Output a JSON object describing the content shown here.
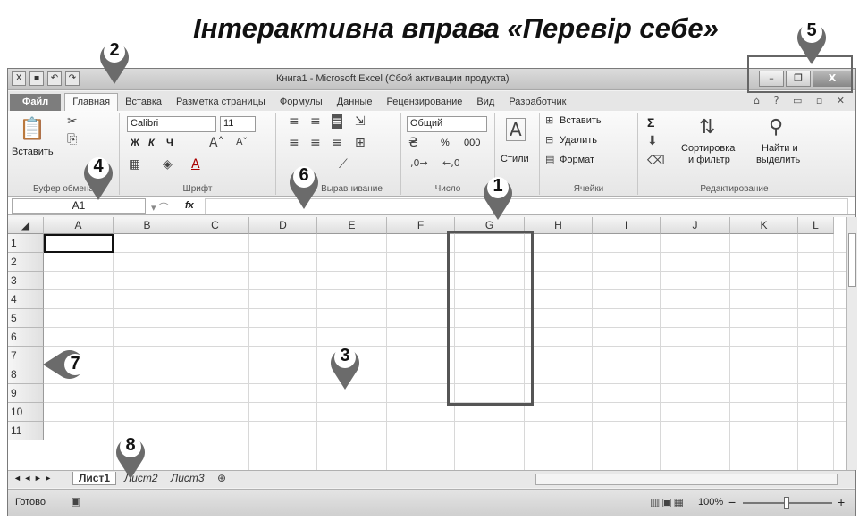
{
  "heading": "Інтерактивна вправа «Перевір себе»",
  "window": {
    "title": "Книга1 - Microsoft Excel (Сбой активации продукта)",
    "qat_icons": [
      "excel-icon",
      "save-icon",
      "undo-icon",
      "redo-icon"
    ],
    "controls": [
      "minimize",
      "restore",
      "close"
    ]
  },
  "tabs": [
    "Файл",
    "Главная",
    "Вставка",
    "Разметка страницы",
    "Формулы",
    "Данные",
    "Рецензирование",
    "Вид",
    "Разработчик"
  ],
  "ribbon": {
    "clipboard": {
      "paste": "Вставить",
      "label": "Буфер обмена"
    },
    "font": {
      "name": "Calibri",
      "size": "11",
      "bold": "Ж",
      "italic": "К",
      "underline": "Ч",
      "label": "Шрифт"
    },
    "alignment": {
      "label": "Выравнивание"
    },
    "number": {
      "format": "Общий",
      "percent": "%",
      "thousands": "000",
      "label": "Число"
    },
    "styles": {
      "label": "Стили"
    },
    "cells": {
      "insert": "Вставить",
      "delete": "Удалить",
      "format": "Формат",
      "label": "Ячейки"
    },
    "editing": {
      "sigma": "Σ",
      "sort": "Сортировка",
      "sort2": "и фильтр",
      "find": "Найти и",
      "find2": "выделить",
      "label": "Редактирование"
    }
  },
  "formula_bar": {
    "name_box": "A1",
    "fx": "fx",
    "value": ""
  },
  "grid": {
    "columns": [
      "A",
      "B",
      "C",
      "D",
      "E",
      "F",
      "G",
      "H",
      "I",
      "J",
      "K",
      "L"
    ],
    "rows": [
      "1",
      "2",
      "3",
      "4",
      "5",
      "6",
      "7",
      "8",
      "9",
      "10",
      "11"
    ],
    "active_cell": "A1",
    "highlighted_column": "G"
  },
  "sheets": {
    "tabs": [
      "Лист1",
      "Лист2",
      "Лист3"
    ],
    "active": "Лист1",
    "nav": "◄ ◄ ► ►"
  },
  "status": {
    "ready": "Готово",
    "zoom": "100%",
    "minus": "−",
    "plus": "+"
  },
  "markers": [
    "1",
    "2",
    "3",
    "4",
    "5",
    "6",
    "7",
    "8"
  ]
}
